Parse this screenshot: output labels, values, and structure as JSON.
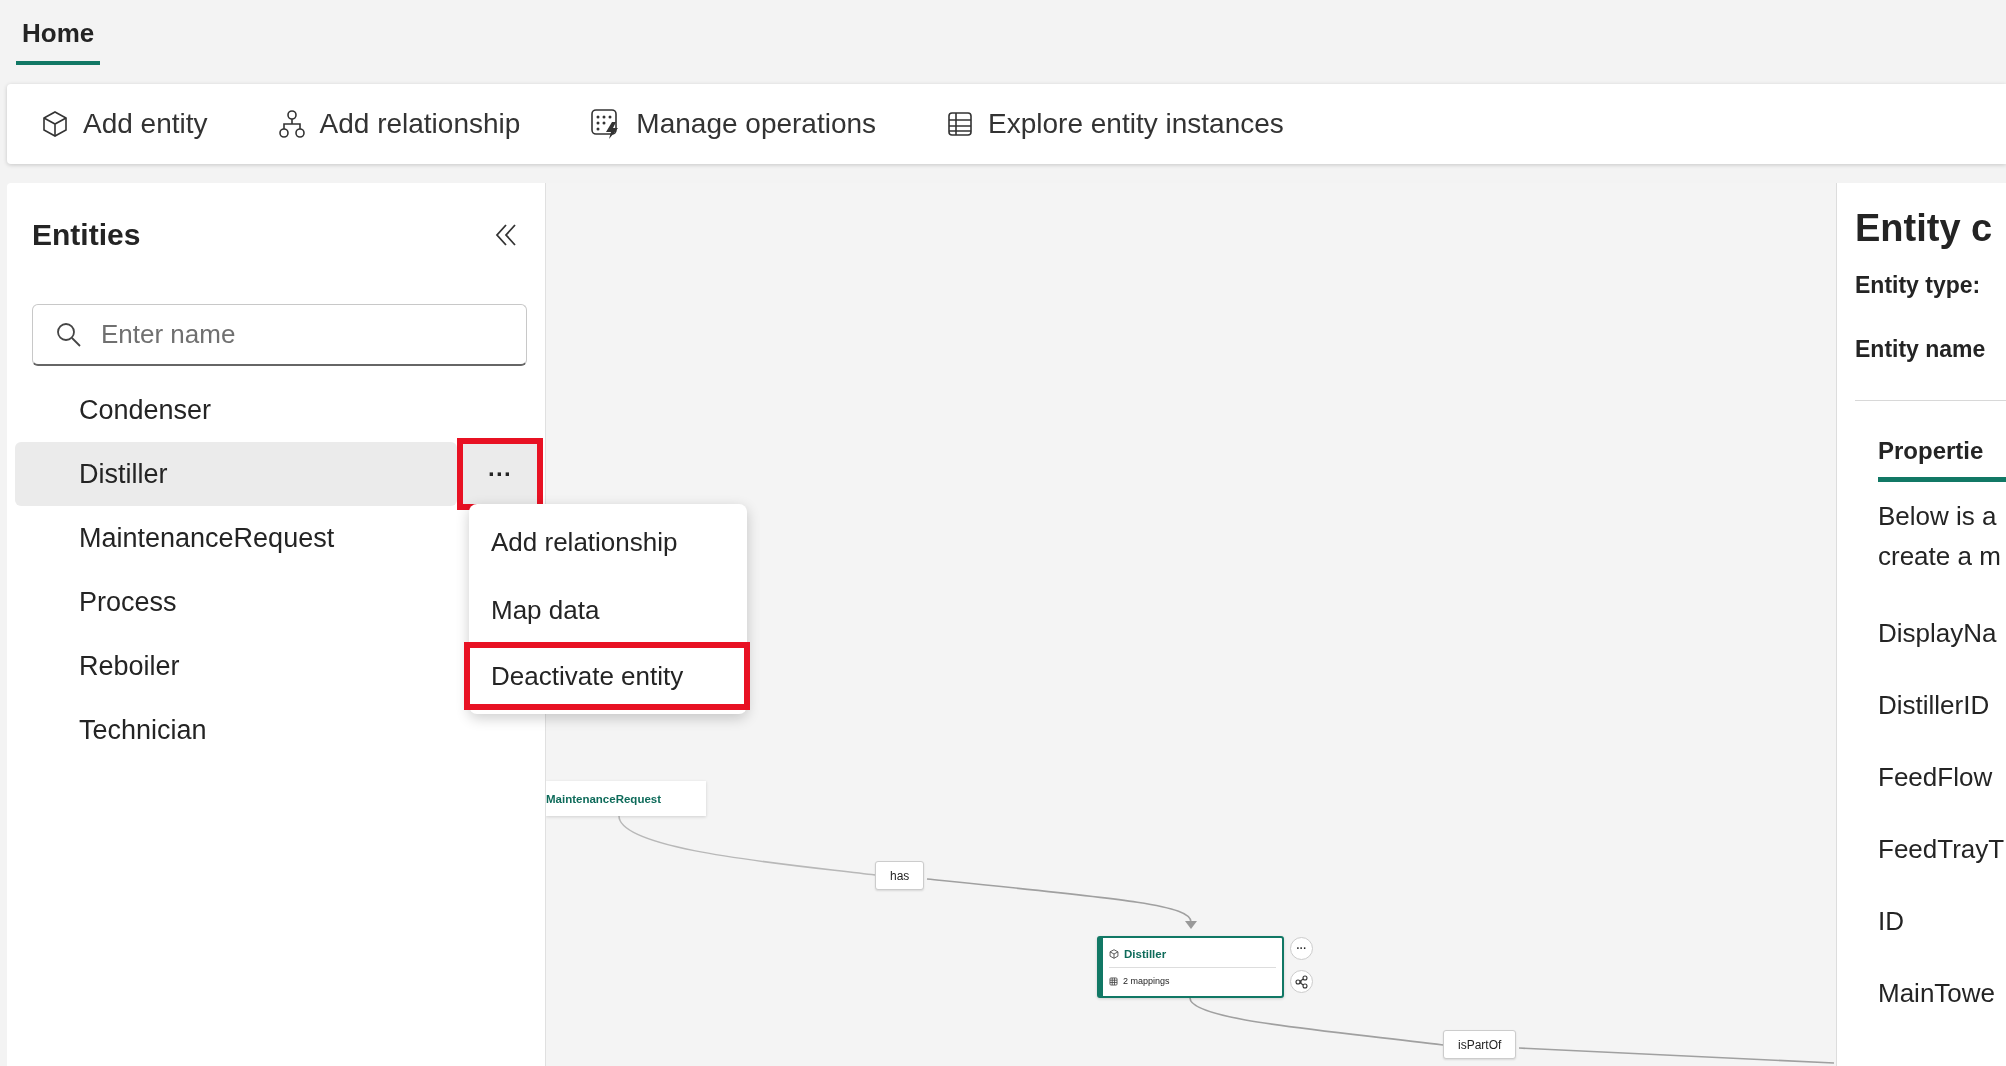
{
  "tabs": [
    {
      "label": "Home",
      "selected": true
    }
  ],
  "toolbar": [
    {
      "label": "Add entity",
      "kind": "cube"
    },
    {
      "label": "Add relationship",
      "kind": "nodes"
    },
    {
      "label": "Manage operations",
      "kind": "operations"
    },
    {
      "label": "Explore entity instances",
      "kind": "table"
    }
  ],
  "sidebar": {
    "title": "Entities",
    "search": {
      "placeholder": "Enter name"
    },
    "items": [
      {
        "name": "Condenser",
        "selected": false
      },
      {
        "name": "Distiller",
        "selected": true,
        "more_button": {
          "label": "···",
          "highlighted": true
        }
      },
      {
        "name": "MaintenanceRequest",
        "selected": false
      },
      {
        "name": "Process",
        "selected": false
      },
      {
        "name": "Reboiler",
        "selected": false
      },
      {
        "name": "Technician",
        "selected": false
      }
    ]
  },
  "context_menu": [
    {
      "label": "Add relationship",
      "highlighted": false
    },
    {
      "label": "Map data",
      "highlighted": false
    },
    {
      "label": "Deactivate entity",
      "highlighted": true
    }
  ],
  "canvas": {
    "nodes": [
      {
        "name": "MaintenanceRequest",
        "kind": "plain"
      },
      {
        "name": "Distiller",
        "kind": "detailed",
        "mappings": "2 mappings",
        "more": "···"
      }
    ],
    "edges": [
      {
        "label": "has"
      },
      {
        "label": "isPartOf"
      }
    ]
  },
  "details": {
    "title": "Entity c",
    "fields": [
      "Entity type:",
      "Entity name"
    ],
    "tabs": [
      {
        "label": "Propertie",
        "selected": true
      }
    ],
    "description": [
      "Below is a",
      "create a m"
    ],
    "properties": [
      "DisplayNa",
      "DistillerID",
      "FeedFlow",
      "FeedTrayT",
      "ID",
      "MainTowe"
    ]
  }
}
